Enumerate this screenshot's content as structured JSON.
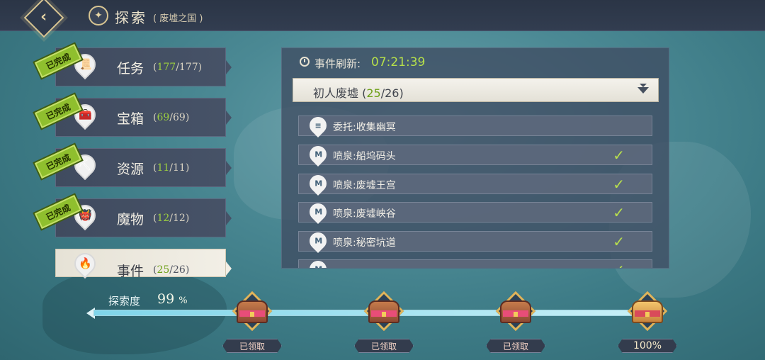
{
  "header": {
    "title": "探索",
    "subtitle": "( 废墟之国 )"
  },
  "categories": [
    {
      "label": "任务",
      "done": "177",
      "total": "/177)",
      "open": "(",
      "stamp": "已完成"
    },
    {
      "label": "宝箱",
      "done": "69",
      "total": "/69)",
      "open": "(",
      "stamp": "已完成"
    },
    {
      "label": "资源",
      "done": "11",
      "total": "/11)",
      "open": "(",
      "stamp": "已完成"
    },
    {
      "label": "魔物",
      "done": "12",
      "total": "/12)",
      "open": "(",
      "stamp": "已完成"
    },
    {
      "label": "事件",
      "done": "25",
      "total": "/26)",
      "open": "("
    }
  ],
  "panel": {
    "refresh_label": "事件刷新:",
    "refresh_time": "07:21:39",
    "area": {
      "name": "初人废墟 (",
      "done": "25",
      "total": "/26)"
    },
    "events": [
      {
        "text": "委托:收集幽冥",
        "icon": "scroll-icon",
        "completed": false
      },
      {
        "text": "喷泉:船坞码头",
        "icon": "fountain-icon",
        "completed": true
      },
      {
        "text": "喷泉:废墟王宫",
        "icon": "fountain-icon",
        "completed": true
      },
      {
        "text": "喷泉:废墟峡谷",
        "icon": "fountain-icon",
        "completed": true
      },
      {
        "text": "喷泉:秘密坑道",
        "icon": "fountain-icon",
        "completed": true
      }
    ]
  },
  "progress": {
    "label": "探索度",
    "value": "99",
    "unit": "%",
    "fraction": 0.99,
    "rewards": [
      {
        "status": "已领取"
      },
      {
        "status": "已领取"
      },
      {
        "status": "已领取"
      },
      {
        "status": "100%"
      }
    ]
  },
  "colors": {
    "accent_green": "#9ccf3f",
    "refresh_time": "#b6e04a",
    "stamp_green": "#8fbf2e"
  }
}
